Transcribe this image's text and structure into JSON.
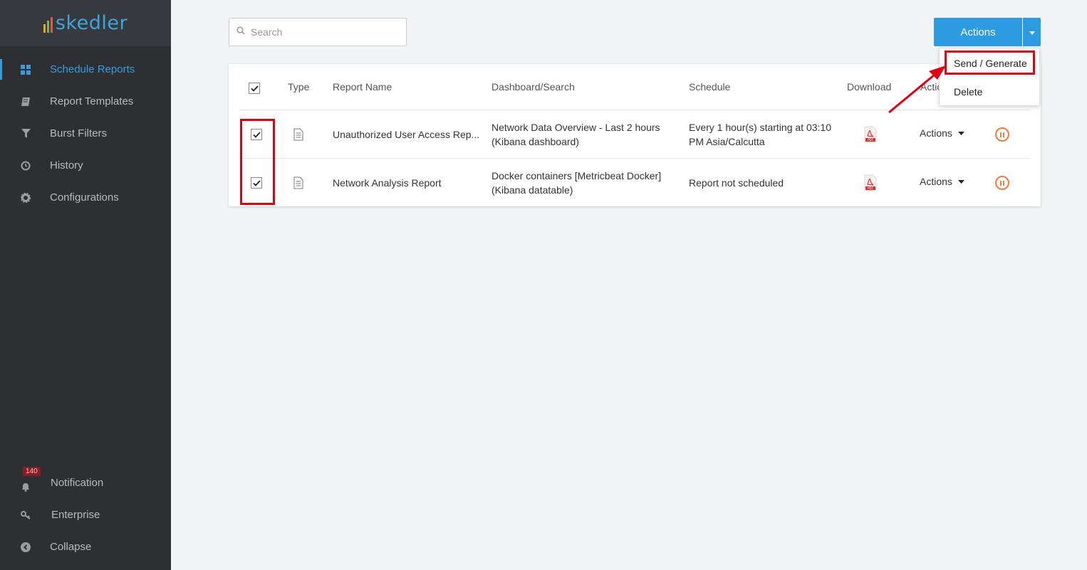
{
  "app": {
    "logo_text": "skedler"
  },
  "sidebar": {
    "items": [
      {
        "label": "Schedule Reports"
      },
      {
        "label": "Report Templates"
      },
      {
        "label": "Burst Filters"
      },
      {
        "label": "History"
      },
      {
        "label": "Configurations"
      }
    ],
    "bottom_items": [
      {
        "label": "Notification",
        "badge": "140"
      },
      {
        "label": "Enterprise"
      },
      {
        "label": "Collapse"
      }
    ]
  },
  "search": {
    "placeholder": "Search"
  },
  "toolbar": {
    "actions_label": "Actions"
  },
  "menu": {
    "items": [
      "Send / Generate",
      "Delete"
    ]
  },
  "table": {
    "columns": [
      "Type",
      "Report Name",
      "Dashboard/Search",
      "Schedule",
      "Download",
      "Actions"
    ],
    "rows": [
      {
        "name": "Unauthorized User Access Rep...",
        "dashboard_line1": "Network Data Overview - Last 2 hours",
        "dashboard_line2": "(Kibana dashboard)",
        "schedule_line1": "Every 1 hour(s) starting at 03:10",
        "schedule_line2": "PM Asia/Calcutta",
        "actions_label": "Actions"
      },
      {
        "name": "Network Analysis Report",
        "dashboard_line1": "Docker containers [Metricbeat Docker]",
        "dashboard_line2": "(Kibana datatable)",
        "schedule_line1": "Report not scheduled",
        "schedule_line2": "",
        "actions_label": "Actions"
      }
    ]
  },
  "colors": {
    "accent": "#2d9be2",
    "sidebar_bg": "#2d2f33",
    "highlight": "#e1000f",
    "pause": "#f07b3f"
  }
}
